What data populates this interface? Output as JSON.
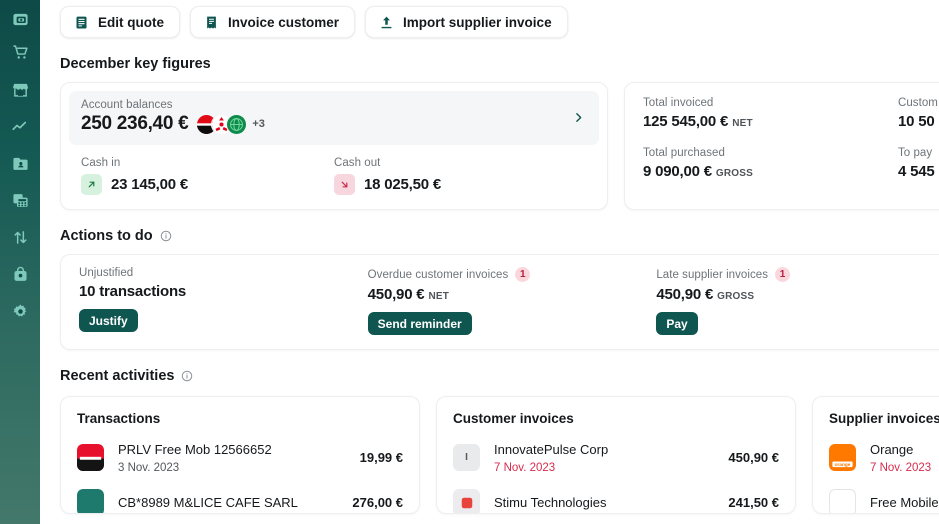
{
  "sidebar": {
    "items": [
      {
        "name": "logo",
        "icon": "wallet-logo-icon"
      },
      {
        "name": "cart",
        "icon": "shopping-cart-icon"
      },
      {
        "name": "store",
        "icon": "storefront-icon"
      },
      {
        "name": "analytics",
        "icon": "line-chart-icon"
      },
      {
        "name": "contacts",
        "icon": "contacts-folder-icon"
      },
      {
        "name": "accounting",
        "icon": "calculator-icon"
      },
      {
        "name": "transfers",
        "icon": "arrows-up-down-icon"
      },
      {
        "name": "briefcase",
        "icon": "briefcase-icon"
      },
      {
        "name": "settings",
        "icon": "gear-icon"
      }
    ]
  },
  "toolbar": {
    "edit_quote": "Edit quote",
    "invoice_customer": "Invoice customer",
    "import_supplier_invoice": "Import supplier invoice"
  },
  "key_figures": {
    "title": "December key figures",
    "account_balances": {
      "label": "Account balances",
      "amount": "250 236,40 €",
      "more_accounts": "+3"
    },
    "cash_in": {
      "label": "Cash in",
      "amount": "23 145,00 €"
    },
    "cash_out": {
      "label": "Cash out",
      "amount": "18 025,50 €"
    },
    "total_invoiced": {
      "label": "Total invoiced",
      "amount": "125 545,00 €",
      "tag": "NET"
    },
    "customer_credit": {
      "label": "Custom",
      "amount": "10 50",
      "tag": ""
    },
    "total_purchased": {
      "label": "Total purchased",
      "amount": "9 090,00 €",
      "tag": "GROSS"
    },
    "to_pay": {
      "label": "To pay",
      "amount": "4 545",
      "tag": ""
    }
  },
  "actions": {
    "title": "Actions to do",
    "items": [
      {
        "label": "Unjustified",
        "badge": "",
        "value": "10 transactions",
        "tag": "",
        "button": "Justify"
      },
      {
        "label": "Overdue customer invoices",
        "badge": "1",
        "value": "450,90 €",
        "tag": "NET",
        "button": "Send reminder"
      },
      {
        "label": "Late supplier invoices",
        "badge": "1",
        "value": "450,90 €",
        "tag": "GROSS",
        "button": "Pay"
      }
    ]
  },
  "recent": {
    "title": "Recent activities",
    "transactions": {
      "title": "Transactions",
      "rows": [
        {
          "name": "PRLV Free Mob 12566652",
          "date": "3 Nov. 2023",
          "amount": "19,99 €",
          "late": false,
          "logo": "free-mobile-logo"
        },
        {
          "name": "CB*8989 M&LICE CAFE SARL",
          "date": "",
          "amount": "276,00 €",
          "late": false,
          "logo": "cafe-logo"
        }
      ]
    },
    "customer_invoices": {
      "title": "Customer invoices",
      "rows": [
        {
          "name": "InnovatePulse Corp",
          "date": "7 Nov. 2023",
          "amount": "450,90 €",
          "late": true,
          "logo": "initial-I"
        },
        {
          "name": "Stimu Technologies",
          "date": "",
          "amount": "241,50 €",
          "late": true,
          "logo": "stimu-logo"
        }
      ]
    },
    "supplier_invoices": {
      "title": "Supplier invoices",
      "rows": [
        {
          "name": "Orange",
          "date": "7 Nov. 2023",
          "amount": "",
          "late": true,
          "logo": "orange-logo"
        },
        {
          "name": "Free Mobile",
          "date": "",
          "amount": "",
          "late": true,
          "logo": "free-logo"
        }
      ]
    }
  },
  "colors": {
    "brand": "#0f5550",
    "sidebar_top": "#0e4a47",
    "sidebar_bottom": "#43786b",
    "late_red": "#d62d4e",
    "cash_in_bg": "#d6f2de",
    "cash_out_bg": "#f7d6dd",
    "badge_bg": "#fbd7dd"
  }
}
